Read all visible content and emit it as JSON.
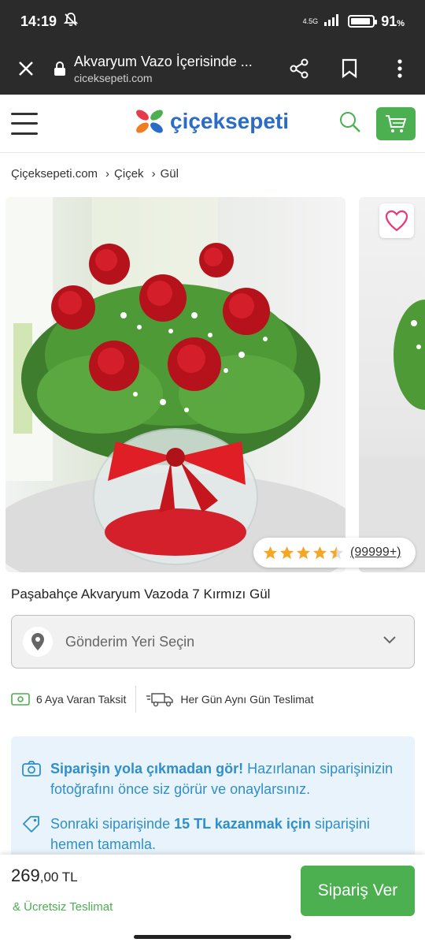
{
  "status_bar": {
    "time": "14:19",
    "network": "4.5G",
    "battery_percent": "91",
    "battery_level": 0.91
  },
  "browser": {
    "title": "Akvaryum Vazo İçerisinde ...",
    "url": "ciceksepeti.com"
  },
  "site": {
    "logo_text": "çiçeksepeti",
    "brand_colors": {
      "green": "#4caf50",
      "blue": "#2a6cc7",
      "orange": "#f07d22",
      "red": "#e83a4d"
    }
  },
  "breadcrumb": [
    "Çiçeksepeti.com",
    "Çiçek",
    "Gül"
  ],
  "product": {
    "title": "Paşabahçe Akvaryum Vazoda 7 Kırmızı Gül",
    "rating_stars": 4.5,
    "rating_count": "(99999+)"
  },
  "delivery": {
    "placeholder": "Gönderim Yeri Seçin"
  },
  "features": [
    {
      "icon": "money-icon",
      "label": "6 Aya Varan Taksit"
    },
    {
      "icon": "delivery-truck-icon",
      "label": "Her Gün Aynı Gün Teslimat"
    }
  ],
  "info": {
    "photo_strong": "Siparişin yola çıkmadan gör!",
    "photo_text": " Hazırlanan siparişinizin fotoğrafını önce siz görür ve onaylarsınız.",
    "coupon_pre": "Sonraki siparişinde ",
    "coupon_strong": "15 TL kazanmak için",
    "coupon_post": " siparişini hemen tamamla."
  },
  "bottom": {
    "price_main": "269",
    "price_dec": ",00 TL",
    "free_shipping": "& Ücretsiz Teslimat",
    "order_button": "Sipariş Ver"
  }
}
